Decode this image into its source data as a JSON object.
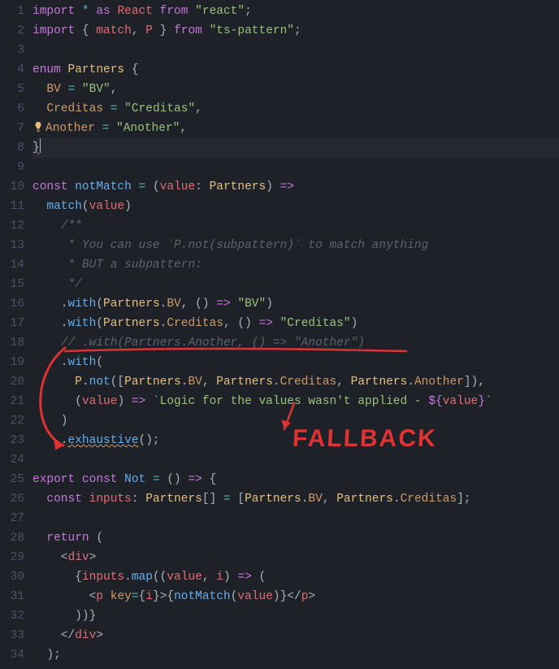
{
  "gutter": {
    "start": 1,
    "end": 34
  },
  "colors": {
    "bg": "#1e2127",
    "keyword": "#c678dd",
    "string": "#98c379",
    "comment": "#5c6370",
    "function": "#61afef",
    "type": "#e5c07b",
    "variable": "#e06c75",
    "punct": "#abb2bf",
    "number": "#d19a66",
    "annotation": "#d33"
  },
  "annotation": {
    "label": "FALLBACK"
  },
  "code": {
    "l1": {
      "t": [
        [
          "k",
          "import"
        ],
        [
          "p",
          " "
        ],
        [
          "op",
          "*"
        ],
        [
          "p",
          " "
        ],
        [
          "k",
          "as"
        ],
        [
          "p",
          " "
        ],
        [
          "v",
          "React"
        ],
        [
          "p",
          " "
        ],
        [
          "k",
          "from"
        ],
        [
          "p",
          " "
        ],
        [
          "s",
          "\"react\""
        ],
        [
          "p",
          ";"
        ]
      ]
    },
    "l2": {
      "t": [
        [
          "k",
          "import"
        ],
        [
          "p",
          " { "
        ],
        [
          "v",
          "match"
        ],
        [
          "p",
          ", "
        ],
        [
          "v",
          "P"
        ],
        [
          "p",
          " } "
        ],
        [
          "k",
          "from"
        ],
        [
          "p",
          " "
        ],
        [
          "s",
          "\"ts-pattern\""
        ],
        [
          "p",
          ";"
        ]
      ]
    },
    "l3": {
      "t": [
        [
          "p",
          ""
        ]
      ]
    },
    "l4": {
      "t": [
        [
          "k",
          "enum"
        ],
        [
          "p",
          " "
        ],
        [
          "t",
          "Partners"
        ],
        [
          "p",
          " {"
        ]
      ]
    },
    "l5": {
      "t": [
        [
          "p",
          "  "
        ],
        [
          "n",
          "BV"
        ],
        [
          "p",
          " "
        ],
        [
          "op",
          "="
        ],
        [
          "p",
          " "
        ],
        [
          "s",
          "\"BV\""
        ],
        [
          "p",
          ","
        ]
      ]
    },
    "l6": {
      "t": [
        [
          "p",
          "  "
        ],
        [
          "n",
          "Creditas"
        ],
        [
          "p",
          " "
        ],
        [
          "op",
          "="
        ],
        [
          "p",
          " "
        ],
        [
          "s",
          "\"Creditas\""
        ],
        [
          "p",
          ","
        ]
      ]
    },
    "l7": {
      "bulb": true,
      "t": [
        [
          "n",
          "Another"
        ],
        [
          "p",
          " "
        ],
        [
          "op",
          "="
        ],
        [
          "p",
          " "
        ],
        [
          "s",
          "\"Another\""
        ],
        [
          "p",
          ","
        ]
      ]
    },
    "l8": {
      "hl": true,
      "cursor": true,
      "t": [
        [
          "sqr",
          "}"
        ]
      ]
    },
    "l9": {
      "t": [
        [
          "p",
          ""
        ]
      ]
    },
    "l10": {
      "t": [
        [
          "k",
          "const"
        ],
        [
          "p",
          " "
        ],
        [
          "fn",
          "notMatch"
        ],
        [
          "p",
          " "
        ],
        [
          "op",
          "="
        ],
        [
          "p",
          " ("
        ],
        [
          "v",
          "value"
        ],
        [
          "p",
          ": "
        ],
        [
          "t",
          "Partners"
        ],
        [
          "p",
          ") "
        ],
        [
          "k",
          "=>"
        ]
      ]
    },
    "l11": {
      "t": [
        [
          "p",
          "  "
        ],
        [
          "fn",
          "match"
        ],
        [
          "p",
          "("
        ],
        [
          "v",
          "value"
        ],
        [
          "p",
          ")"
        ]
      ]
    },
    "l12": {
      "t": [
        [
          "p",
          "    "
        ],
        [
          "c",
          "/**"
        ]
      ]
    },
    "l13": {
      "t": [
        [
          "p",
          "    "
        ],
        [
          "c",
          " * You can use `P.not(subpattern)` to match anything"
        ]
      ]
    },
    "l14": {
      "t": [
        [
          "p",
          "    "
        ],
        [
          "c",
          " * BUT a subpattern:"
        ]
      ]
    },
    "l15": {
      "t": [
        [
          "p",
          "    "
        ],
        [
          "c",
          " */"
        ]
      ]
    },
    "l16": {
      "t": [
        [
          "p",
          "    ."
        ],
        [
          "fn",
          "with"
        ],
        [
          "p",
          "("
        ],
        [
          "t",
          "Partners"
        ],
        [
          "p",
          "."
        ],
        [
          "n",
          "BV"
        ],
        [
          "p",
          ", () "
        ],
        [
          "k",
          "=>"
        ],
        [
          "p",
          " "
        ],
        [
          "s",
          "\"BV\""
        ],
        [
          "p",
          ")"
        ]
      ]
    },
    "l17": {
      "t": [
        [
          "p",
          "    ."
        ],
        [
          "fn",
          "with"
        ],
        [
          "p",
          "("
        ],
        [
          "t",
          "Partners"
        ],
        [
          "p",
          "."
        ],
        [
          "n",
          "Creditas"
        ],
        [
          "p",
          ", () "
        ],
        [
          "k",
          "=>"
        ],
        [
          "p",
          " "
        ],
        [
          "s",
          "\"Creditas\""
        ],
        [
          "p",
          ")"
        ]
      ]
    },
    "l18": {
      "t": [
        [
          "p",
          "    "
        ],
        [
          "c",
          "// .with(Partners.Another, () => \"Another\")"
        ]
      ]
    },
    "l19": {
      "t": [
        [
          "p",
          "    ."
        ],
        [
          "fn",
          "with"
        ],
        [
          "p",
          "("
        ]
      ]
    },
    "l20": {
      "t": [
        [
          "p",
          "      "
        ],
        [
          "t",
          "P"
        ],
        [
          "p",
          "."
        ],
        [
          "fn",
          "not"
        ],
        [
          "p",
          "(["
        ],
        [
          "t",
          "Partners"
        ],
        [
          "p",
          "."
        ],
        [
          "n",
          "BV"
        ],
        [
          "p",
          ", "
        ],
        [
          "t",
          "Partners"
        ],
        [
          "p",
          "."
        ],
        [
          "n",
          "Creditas"
        ],
        [
          "p",
          ", "
        ],
        [
          "t",
          "Partners"
        ],
        [
          "p",
          "."
        ],
        [
          "n",
          "Another"
        ],
        [
          "p",
          "]),"
        ]
      ]
    },
    "l21": {
      "t": [
        [
          "p",
          "      ("
        ],
        [
          "v",
          "value"
        ],
        [
          "p",
          ") "
        ],
        [
          "k",
          "=>"
        ],
        [
          "p",
          " "
        ],
        [
          "s",
          "`Logic for the values wasn't applied - "
        ],
        [
          "k",
          "${"
        ],
        [
          "v",
          "value"
        ],
        [
          "k",
          "}"
        ],
        [
          "s",
          "`"
        ]
      ]
    },
    "l22": {
      "t": [
        [
          "p",
          "    )"
        ]
      ]
    },
    "l23": {
      "t": [
        [
          "p",
          "    ."
        ],
        [
          "sqy",
          "exhaustive"
        ],
        [
          "p",
          "();"
        ]
      ]
    },
    "l24": {
      "t": [
        [
          "p",
          ""
        ]
      ]
    },
    "l25": {
      "t": [
        [
          "k",
          "export"
        ],
        [
          "p",
          " "
        ],
        [
          "k",
          "const"
        ],
        [
          "p",
          " "
        ],
        [
          "fn",
          "Not"
        ],
        [
          "p",
          " "
        ],
        [
          "op",
          "="
        ],
        [
          "p",
          " () "
        ],
        [
          "k",
          "=>"
        ],
        [
          "p",
          " {"
        ]
      ]
    },
    "l26": {
      "t": [
        [
          "p",
          "  "
        ],
        [
          "k",
          "const"
        ],
        [
          "p",
          " "
        ],
        [
          "v",
          "inputs"
        ],
        [
          "p",
          ": "
        ],
        [
          "t",
          "Partners"
        ],
        [
          "p",
          "[] "
        ],
        [
          "op",
          "="
        ],
        [
          "p",
          " ["
        ],
        [
          "t",
          "Partners"
        ],
        [
          "p",
          "."
        ],
        [
          "n",
          "BV"
        ],
        [
          "p",
          ", "
        ],
        [
          "t",
          "Partners"
        ],
        [
          "p",
          "."
        ],
        [
          "n",
          "Creditas"
        ],
        [
          "p",
          "];"
        ]
      ]
    },
    "l27": {
      "t": [
        [
          "p",
          ""
        ]
      ]
    },
    "l28": {
      "t": [
        [
          "p",
          "  "
        ],
        [
          "k",
          "return"
        ],
        [
          "p",
          " ("
        ]
      ]
    },
    "l29": {
      "t": [
        [
          "p",
          "    <"
        ],
        [
          "v",
          "div"
        ],
        [
          "p",
          ">"
        ]
      ]
    },
    "l30": {
      "t": [
        [
          "p",
          "      {"
        ],
        [
          "v",
          "inputs"
        ],
        [
          "p",
          "."
        ],
        [
          "fn",
          "map"
        ],
        [
          "p",
          "(("
        ],
        [
          "v",
          "value"
        ],
        [
          "p",
          ", "
        ],
        [
          "v",
          "i"
        ],
        [
          "p",
          ") "
        ],
        [
          "k",
          "=>"
        ],
        [
          "p",
          " ("
        ]
      ]
    },
    "l31": {
      "t": [
        [
          "p",
          "        <"
        ],
        [
          "v",
          "p"
        ],
        [
          "p",
          " "
        ],
        [
          "n",
          "key"
        ],
        [
          "op",
          "="
        ],
        [
          "p",
          "{"
        ],
        [
          "v",
          "i"
        ],
        [
          "p",
          "}>{"
        ],
        [
          "fn",
          "notMatch"
        ],
        [
          "p",
          "("
        ],
        [
          "v",
          "value"
        ],
        [
          "p",
          ")}</"
        ],
        [
          "v",
          "p"
        ],
        [
          "p",
          ">"
        ]
      ]
    },
    "l32": {
      "t": [
        [
          "p",
          "      ))}"
        ]
      ]
    },
    "l33": {
      "t": [
        [
          "p",
          "    </"
        ],
        [
          "v",
          "div"
        ],
        [
          "p",
          ">"
        ]
      ]
    },
    "l34": {
      "t": [
        [
          "p",
          "  );"
        ]
      ]
    }
  }
}
